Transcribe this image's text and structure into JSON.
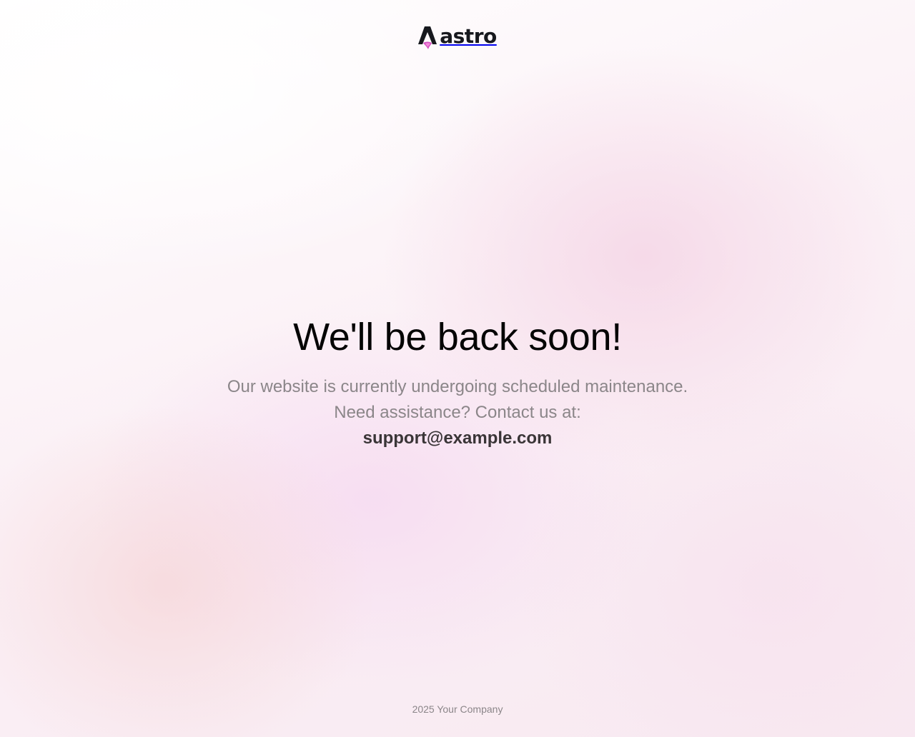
{
  "brand": {
    "logo_text": "astro",
    "logo_icon": "astro-logo-icon",
    "accent_colors": [
      "#17191e",
      "#c64fb7",
      "#ef6cd0"
    ]
  },
  "main": {
    "title": "We'll be back soon!",
    "message_line_1": "Our website is currently undergoing scheduled maintenance.",
    "message_line_2": "Need assistance? Contact us at:",
    "email": "support@example.com"
  },
  "footer": {
    "text": "2025 Your Company"
  }
}
